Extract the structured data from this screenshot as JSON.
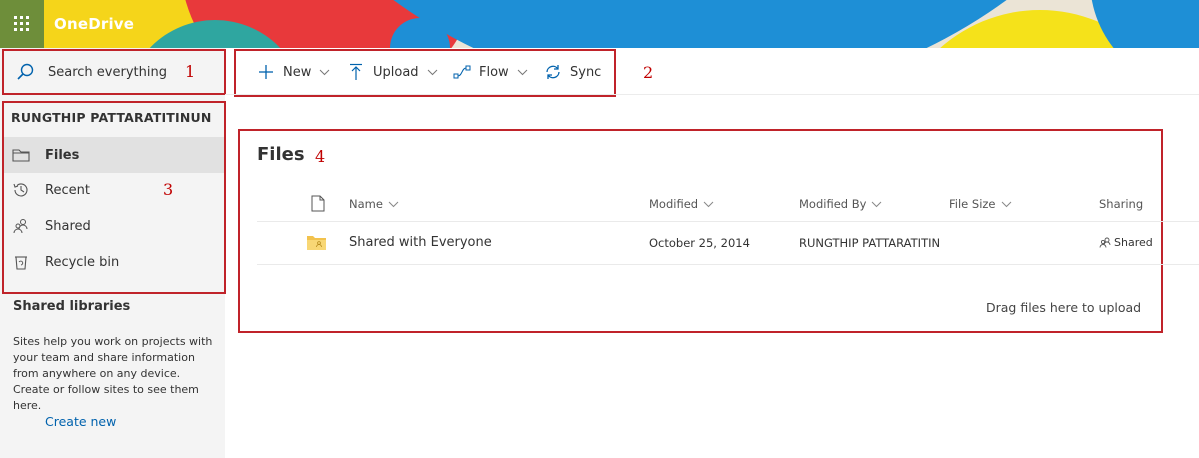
{
  "header": {
    "brand": "OneDrive",
    "waffle_icon": "app-launcher-icon",
    "colors": {
      "waffle_bg": "#6e8e3a",
      "red": "#e8393b",
      "blue": "#1e8fd6",
      "yellow": "#f5e21a",
      "teal": "#2fa6a0"
    }
  },
  "search": {
    "placeholder": "Search everything",
    "icon": "search-icon"
  },
  "annotations": [
    "1",
    "2",
    "3",
    "4"
  ],
  "sidebar": {
    "owner": "RUNGTHIP PATTARATITINUN",
    "items": [
      {
        "label": "Files",
        "icon": "folder-icon",
        "selected": true
      },
      {
        "label": "Recent",
        "icon": "history-icon",
        "selected": false
      },
      {
        "label": "Shared",
        "icon": "people-icon",
        "selected": false
      },
      {
        "label": "Recycle bin",
        "icon": "recycle-bin-icon",
        "selected": false
      }
    ],
    "shared_libraries": {
      "title": "Shared libraries",
      "description": "Sites help you work on projects with your team and share information from anywhere on any device. Create or follow sites to see them here.",
      "create_new": "Create new"
    }
  },
  "commands": [
    {
      "label": "New",
      "icon": "plus-icon",
      "has_dropdown": true
    },
    {
      "label": "Upload",
      "icon": "upload-icon",
      "has_dropdown": true
    },
    {
      "label": "Flow",
      "icon": "flow-icon",
      "has_dropdown": true
    },
    {
      "label": "Sync",
      "icon": "sync-icon",
      "has_dropdown": false
    }
  ],
  "files": {
    "title": "Files",
    "columns": {
      "name": "Name",
      "modified": "Modified",
      "modified_by": "Modified By",
      "file_size": "File Size",
      "sharing": "Sharing"
    },
    "rows": [
      {
        "name": "Shared with Everyone",
        "modified": "October 25, 2014",
        "modified_by": "RUNGTHIP PATTARATITIN",
        "file_size": "",
        "sharing": "Shared"
      }
    ],
    "drag_hint": "Drag files here to upload"
  }
}
